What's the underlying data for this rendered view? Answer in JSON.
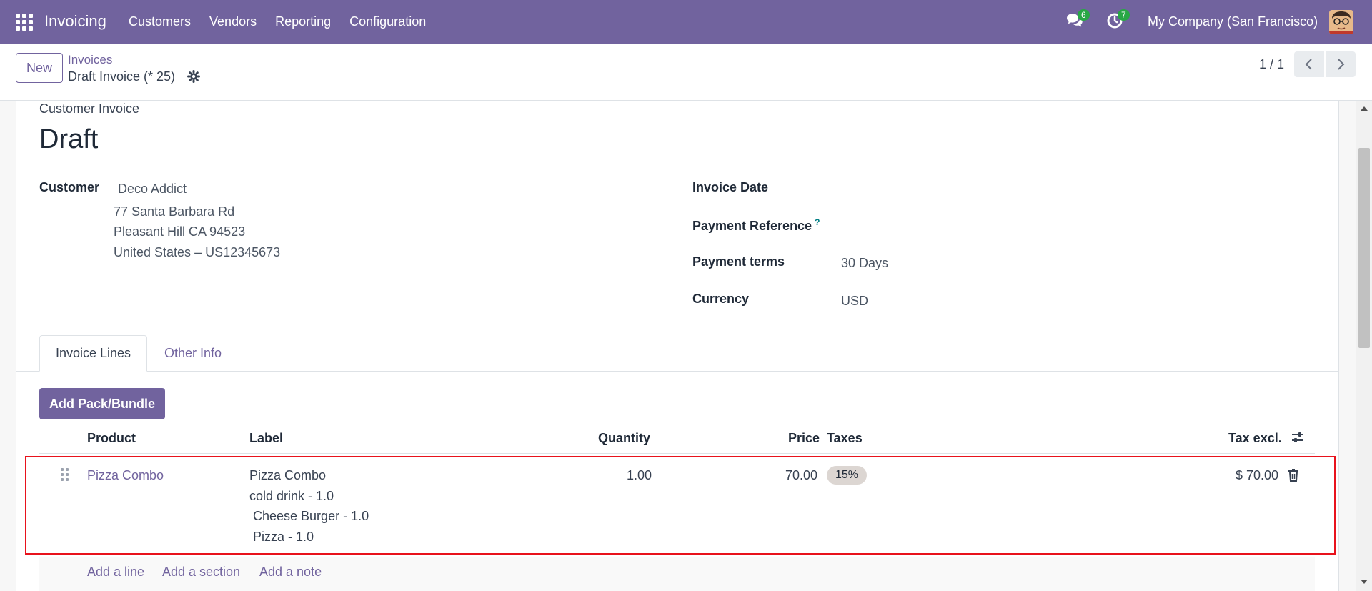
{
  "navbar": {
    "app_name": "Invoicing",
    "menu": [
      "Customers",
      "Vendors",
      "Reporting",
      "Configuration"
    ],
    "messages_count": "6",
    "activities_count": "7",
    "company": "My Company (San Francisco)"
  },
  "control_panel": {
    "new_label": "New",
    "breadcrumb_parent": "Invoices",
    "breadcrumb_current": "Draft Invoice (* 25)",
    "pager_value": "1 / 1"
  },
  "form": {
    "doc_type": "Customer Invoice",
    "title": "Draft",
    "customer_label": "Customer",
    "customer_name": "Deco Addict",
    "customer_address": [
      "77 Santa Barbara Rd",
      "Pleasant Hill CA 94523",
      "United States – US12345673"
    ],
    "invoice_date_label": "Invoice Date",
    "payment_reference_label": "Payment Reference",
    "payment_reference_help": "?",
    "payment_terms_label": "Payment terms",
    "payment_terms_value": "30 Days",
    "currency_label": "Currency",
    "currency_value": "USD"
  },
  "tabs": [
    "Invoice Lines",
    "Other Info"
  ],
  "actions": {
    "add_pack": "Add Pack/Bundle"
  },
  "lines_table": {
    "headers": {
      "product": "Product",
      "label": "Label",
      "quantity": "Quantity",
      "price": "Price",
      "taxes": "Taxes",
      "tax_excl": "Tax excl."
    },
    "rows": [
      {
        "product": "Pizza Combo",
        "label_lines": [
          "Pizza Combo",
          "cold drink - 1.0",
          " Cheese Burger - 1.0",
          " Pizza - 1.0"
        ],
        "quantity": "1.00",
        "price": "70.00",
        "tax": "15%",
        "tax_excl": "$ 70.00"
      }
    ],
    "add_links": [
      "Add a line",
      "Add a section",
      "Add a note"
    ]
  },
  "colors": {
    "brand": "#71639e",
    "highlight_border": "#e8121c",
    "badge": "#28a745"
  }
}
